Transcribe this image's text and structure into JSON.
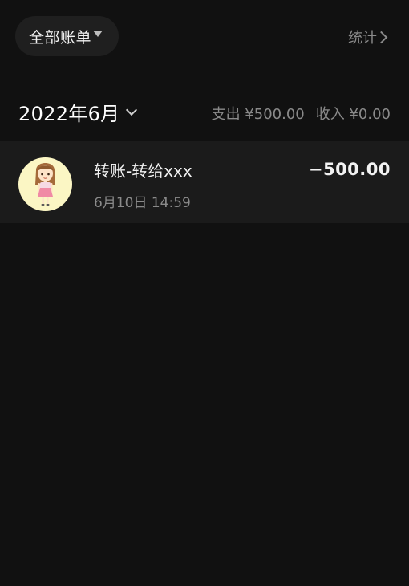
{
  "header": {
    "filter_label": "全部账单",
    "stats_label": "统计"
  },
  "month": {
    "label": "2022年6月",
    "expense": "支出 ¥500.00",
    "income": "收入 ¥0.00"
  },
  "transactions": [
    {
      "title": "转账-转给xxx",
      "time": "6月10日 14:59",
      "amount": "−500.00",
      "avatar_icon": "girl-avatar-icon"
    }
  ],
  "colors": {
    "background": "#111111",
    "row_background": "#1b1b1b",
    "pill_background": "#1f1f1f",
    "muted_text": "#8a8a8a",
    "avatar_background": "#fbf6c4"
  }
}
